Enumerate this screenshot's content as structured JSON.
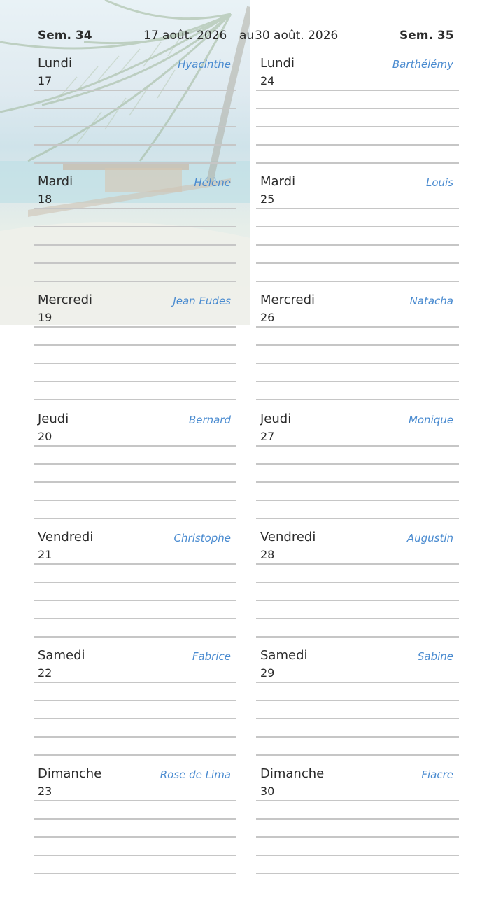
{
  "header": {
    "week_left": "Sem. 34",
    "date_from": "17 août. 2026",
    "connector": "au",
    "date_to": "30 août. 2026",
    "week_right": "Sem. 35"
  },
  "colors": {
    "saint": "#4a8bd0",
    "line": "#c6c6c6",
    "text": "#2b2b2b"
  },
  "columns": [
    {
      "days": [
        {
          "name": "Lundi",
          "number": "17",
          "saint": "Hyacinthe"
        },
        {
          "name": "Mardi",
          "number": "18",
          "saint": "Hélène"
        },
        {
          "name": "Mercredi",
          "number": "19",
          "saint": "Jean Eudes"
        },
        {
          "name": "Jeudi",
          "number": "20",
          "saint": "Bernard"
        },
        {
          "name": "Vendredi",
          "number": "21",
          "saint": "Christophe"
        },
        {
          "name": "Samedi",
          "number": "22",
          "saint": "Fabrice"
        },
        {
          "name": "Dimanche",
          "number": "23",
          "saint": "Rose de Lima"
        }
      ]
    },
    {
      "days": [
        {
          "name": "Lundi",
          "number": "24",
          "saint": "Barthélémy"
        },
        {
          "name": "Mardi",
          "number": "25",
          "saint": "Louis"
        },
        {
          "name": "Mercredi",
          "number": "26",
          "saint": "Natacha"
        },
        {
          "name": "Jeudi",
          "number": "27",
          "saint": "Monique"
        },
        {
          "name": "Vendredi",
          "number": "28",
          "saint": "Augustin"
        },
        {
          "name": "Samedi",
          "number": "29",
          "saint": "Sabine"
        },
        {
          "name": "Dimanche",
          "number": "30",
          "saint": "Fiacre"
        }
      ]
    }
  ]
}
